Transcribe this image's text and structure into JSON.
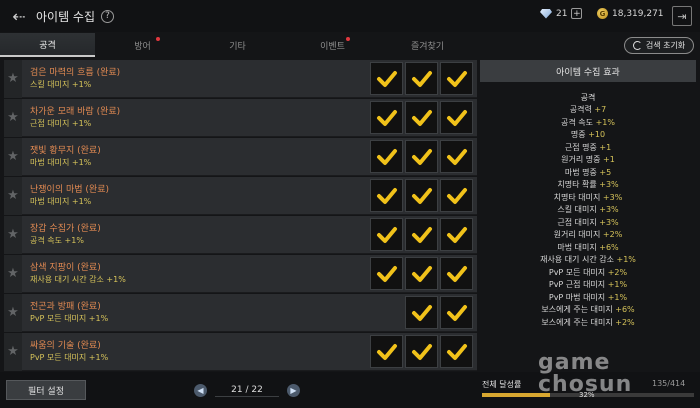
{
  "header": {
    "title": "아이템 수집",
    "gems": "21",
    "gold": "18,319,271"
  },
  "tabs": [
    {
      "label": "공격",
      "active": true,
      "dot": false
    },
    {
      "label": "방어",
      "active": false,
      "dot": true
    },
    {
      "label": "기타",
      "active": false,
      "dot": false
    },
    {
      "label": "이벤트",
      "active": false,
      "dot": true
    },
    {
      "label": "즐겨찾기",
      "active": false,
      "dot": false
    }
  ],
  "reset_label": "검색 초기화",
  "collections": [
    {
      "name": "검은 마력의 흐름",
      "status": "(완료)",
      "effect": "스킬 대미지 +1%",
      "slots": 3
    },
    {
      "name": "차가운 모래 바람",
      "status": "(완료)",
      "effect": "근접 대미지 +1%",
      "slots": 3
    },
    {
      "name": "잿빛 황무지",
      "status": "(완료)",
      "effect": "마법 대미지 +1%",
      "slots": 3
    },
    {
      "name": "난쟁이의 마법",
      "status": "(완료)",
      "effect": "마법 대미지 +1%",
      "slots": 3
    },
    {
      "name": "장갑 수집가",
      "status": "(완료)",
      "effect": "공격 속도 +1%",
      "slots": 3
    },
    {
      "name": "삼색 지팡이",
      "status": "(완료)",
      "effect": "재사용 대기 시간 감소 +1%",
      "slots": 3
    },
    {
      "name": "전곤과 방패",
      "status": "(완료)",
      "effect": "PvP 모든 대미지 +1%",
      "slots": 2
    },
    {
      "name": "싸움의 기술",
      "status": "(완료)",
      "effect": "PvP 모든 대미지 +1%",
      "slots": 3
    }
  ],
  "side": {
    "title": "아이템 수집 효과",
    "section": "공격",
    "stats": [
      {
        "label": "공격력",
        "value": "+7"
      },
      {
        "label": "공격 속도",
        "value": "+1%"
      },
      {
        "label": "명중",
        "value": "+10"
      },
      {
        "label": "근접 명중",
        "value": "+1"
      },
      {
        "label": "원거리 명중",
        "value": "+1"
      },
      {
        "label": "마법 명중",
        "value": "+5"
      },
      {
        "label": "치명타 확률",
        "value": "+3%"
      },
      {
        "label": "치명타 대미지",
        "value": "+3%"
      },
      {
        "label": "스킬 대미지",
        "value": "+3%"
      },
      {
        "label": "근접 대미지",
        "value": "+3%"
      },
      {
        "label": "원거리 대미지",
        "value": "+2%"
      },
      {
        "label": "마법 대미지",
        "value": "+6%"
      },
      {
        "label": "재사용 대기 시간 감소",
        "value": "+1%"
      },
      {
        "label": "PvP 모든 대미지",
        "value": "+2%"
      },
      {
        "label": "PvP 근접 대미지",
        "value": "+1%"
      },
      {
        "label": "PvP 마법 대미지",
        "value": "+1%"
      },
      {
        "label": "보스에게 주는 대미지",
        "value": "+6%"
      },
      {
        "label": "보스에게 주는 대미지",
        "value": "+2%"
      }
    ]
  },
  "footer": {
    "filter_label": "필터 설정",
    "page": "21 / 22",
    "rate_label": "전체 달성률",
    "rate_count": "135/414",
    "rate_percent": "32%",
    "rate_fraction": 0.32
  },
  "watermark": {
    "line1": "game",
    "line2": "chosun"
  }
}
